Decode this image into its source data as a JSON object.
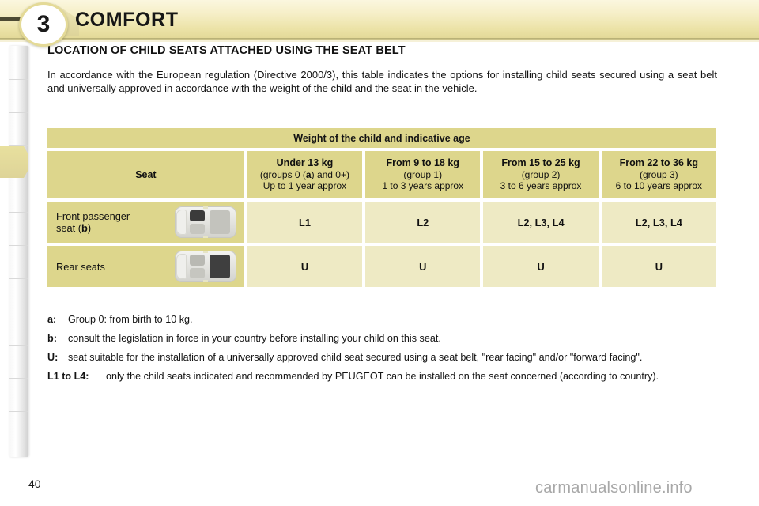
{
  "header": {
    "chapter_number": "3",
    "chapter_title": "COMFORT"
  },
  "section": {
    "title": "LOCATION OF CHILD SEATS ATTACHED USING THE SEAT BELT",
    "intro": "In accordance with the European regulation (Directive 2000/3), this table indicates the options for installing child seats secured using a seat belt and universally approved in accordance with the weight of the child and the seat in the vehicle."
  },
  "table": {
    "band_title": "Weight of the child and indicative age",
    "seat_column_header": "Seat",
    "group_columns": [
      {
        "main": "Under 13 kg",
        "sub1_pre": "(groups 0 (",
        "sub1_bold": "a",
        "sub1_post": ") and 0+)",
        "sub2": "Up to 1 year approx"
      },
      {
        "main": "From 9 to 18 kg",
        "sub1": "(group 1)",
        "sub2": "1 to 3 years approx"
      },
      {
        "main": "From 15 to 25 kg",
        "sub1": "(group 2)",
        "sub2": "3 to 6 years approx"
      },
      {
        "main": "From 22 to 36 kg",
        "sub1": "(group 3)",
        "sub2": "6 to 10 years approx"
      }
    ],
    "rows": [
      {
        "label_line1": "Front passenger",
        "label_line2_pre": "seat (",
        "label_line2_bold": "b",
        "label_line2_post": ")",
        "highlight": "front",
        "values": [
          "L1",
          "L2",
          "L2, L3, L4",
          "L2, L3, L4"
        ]
      },
      {
        "label_line1": "Rear seats",
        "label_line2_pre": "",
        "label_line2_bold": "",
        "label_line2_post": "",
        "highlight": "rear",
        "values": [
          "U",
          "U",
          "U",
          "U"
        ]
      }
    ]
  },
  "legend": [
    {
      "key": "a:",
      "text": "Group 0: from birth to 10 kg."
    },
    {
      "key": "b:",
      "text": "consult the legislation in force in your country before installing your child on this seat."
    },
    {
      "key": "U:",
      "text": "seat suitable for the installation of a universally approved child seat secured using a seat belt, \"rear facing\" and/or \"forward facing\"."
    },
    {
      "key": "L1 to L4:",
      "text": "only the child seats indicated and recommended by PEUGEOT can be installed on the seat concerned (according to country)."
    }
  ],
  "footer": {
    "page_number": "40",
    "watermark": "carmanualsonline.info"
  },
  "colors": {
    "banner_top": "#fbf7df",
    "banner_bottom": "#e3d998",
    "table_header_fill": "#ddd68c",
    "table_cell_fill": "#eeeac4",
    "active_tab": "#e8e09e",
    "text": "#131313"
  }
}
